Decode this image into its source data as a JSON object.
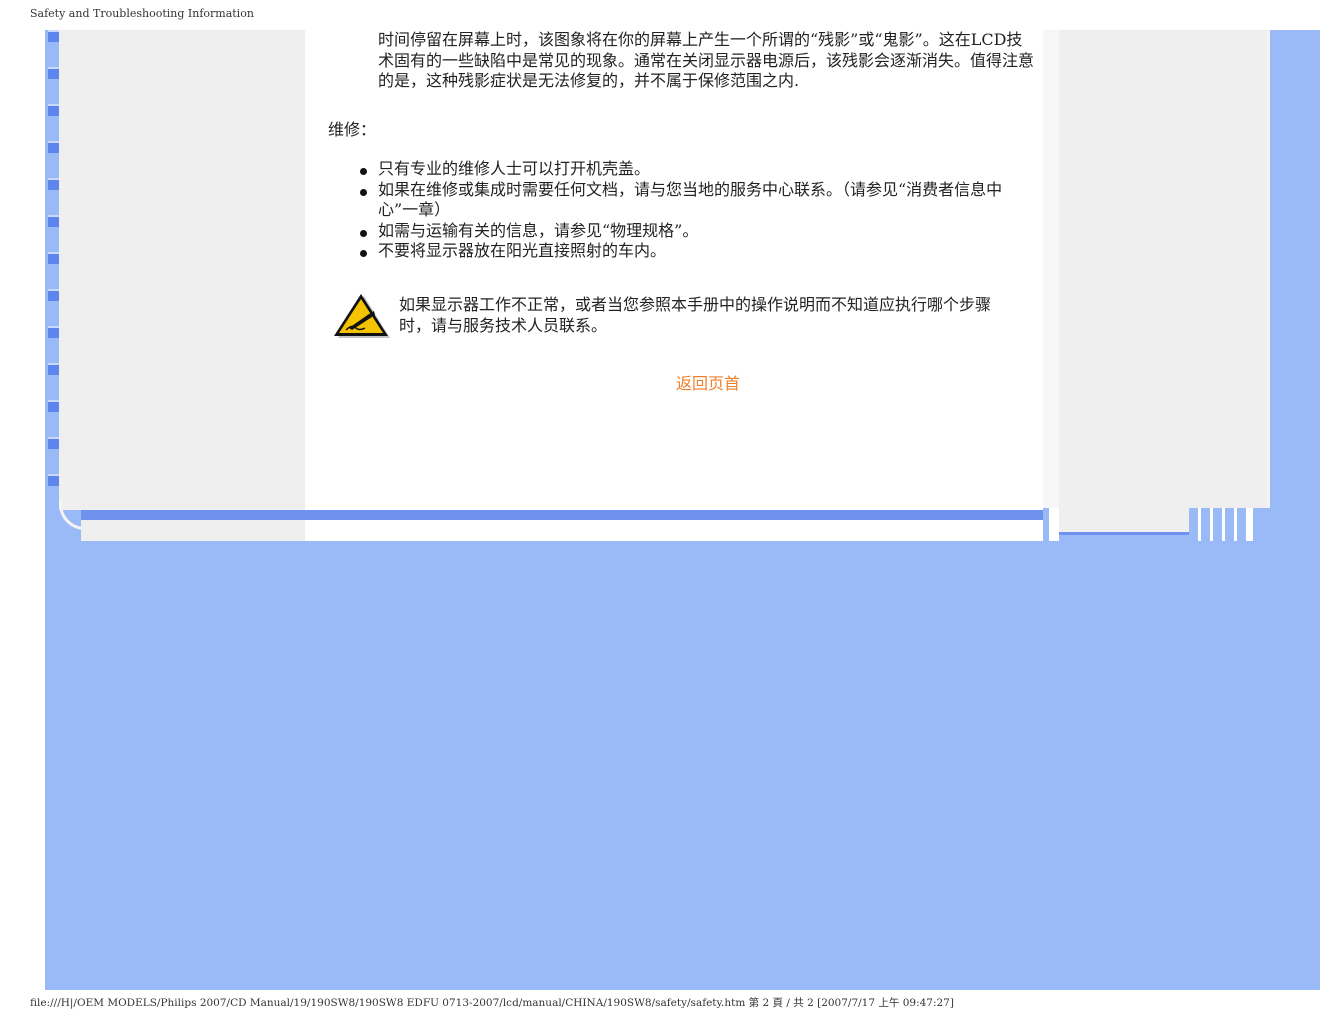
{
  "header": {
    "title": "Safety and Troubleshooting Information"
  },
  "content": {
    "paragraph_top": "时间停留在屏幕上时，该图象将在你的屏幕上产生一个所谓的“残影”或“鬼影”。这在LCD技术固有的一些缺陷中是常见的现象。通常在关闭显示器电源后，该残影会逐渐消失。值得注意的是，这种残影症状是无法修复的，并不属于保修范围之内.",
    "repair_heading": "维修：",
    "repair_items": [
      "只有专业的维修人士可以打开机壳盖。",
      "如果在维修或集成时需要任何文档，请与您当地的服务中心联系。（请参见“消费者信息中心”一章）",
      "如需与运输有关的信息，请参见“物理规格”。",
      "不要将显示器放在阳光直接照射的车内。"
    ],
    "warning_text": "如果显示器工作不正常，或者当您参照本手册中的操作说明而不知道应执行哪个步骤时，请与服务技术人员联系。",
    "warning_icon": "warning-triangle-icon",
    "back_to_top": "返回页首"
  },
  "footer": {
    "path": "file:///H|/OEM MODELS/Philips 2007/CD Manual/19/190SW8/190SW8 EDFU 0713-2007/lcd/manual/CHINA/190SW8/safety/safety.htm 第 2 頁 / 共 2  [2007/7/17 上午 09:47:27]"
  },
  "colors": {
    "frame_blue": "#9ab9f7",
    "accent_blue": "#6f92ee",
    "link_orange": "#f07f2c"
  }
}
